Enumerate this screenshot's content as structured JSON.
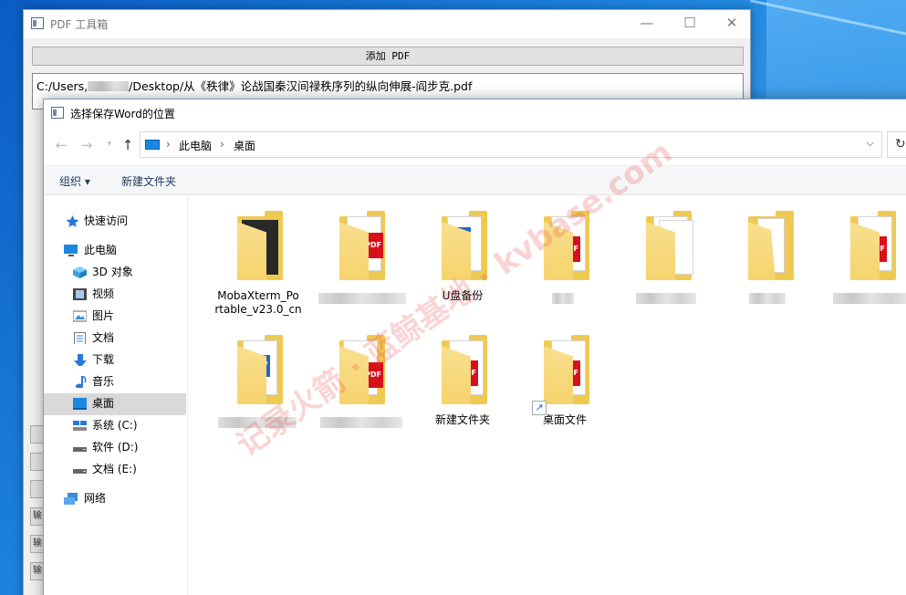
{
  "pdf_window": {
    "title": "PDF 工具箱",
    "add_button": "添加 PDF",
    "path_prefix": "C:/Users,",
    "path_suffix": "/Desktop/从《秩律》论战国秦汉间禄秩序列的纵向伸展-阎步克.pdf",
    "minimize": "—",
    "maximize": "☐",
    "close": "✕",
    "side_stub_1": "输",
    "side_stub_2": "输",
    "side_stub_3": "输"
  },
  "dialog": {
    "title": "选择保存Word的位置",
    "address": {
      "seg1": "此电脑",
      "seg2": "桌面",
      "sep": "›"
    },
    "nav_arrows": {
      "back": "←",
      "forward": "→",
      "recent": "▾",
      "up": "↑",
      "dropdown": "⌵",
      "refresh": "↻"
    },
    "toolbar": {
      "organize": "组织 ▾",
      "new_folder": "新建文件夹"
    },
    "nav_pane": [
      {
        "label": "快速访问",
        "icon": "star-icon"
      },
      {
        "label": "此电脑",
        "icon": "computer-icon"
      },
      {
        "label": "3D 对象",
        "icon": "cube-icon"
      },
      {
        "label": "视频",
        "icon": "video-icon"
      },
      {
        "label": "图片",
        "icon": "picture-icon"
      },
      {
        "label": "文档",
        "icon": "document-icon"
      },
      {
        "label": "下载",
        "icon": "download-icon"
      },
      {
        "label": "音乐",
        "icon": "music-icon"
      },
      {
        "label": "桌面",
        "icon": "desktop-icon",
        "selected": true
      },
      {
        "label": "系统 (C:)",
        "icon": "system-drive-icon"
      },
      {
        "label": "软件 (D:)",
        "icon": "drive-icon"
      },
      {
        "label": "文档 (E:)",
        "icon": "drive-icon"
      },
      {
        "label": "网络",
        "icon": "network-icon"
      }
    ],
    "files": [
      {
        "label": "MobaXterm_Po",
        "label2": "rtable_v23.0_cn",
        "kind": "moba"
      },
      {
        "label": "",
        "kind": "folder-pdf"
      },
      {
        "label": "U盘备份",
        "kind": "folder-word"
      },
      {
        "label": "",
        "kind": "folder-pdf"
      },
      {
        "label": "",
        "kind": "folder-docs"
      },
      {
        "label": "",
        "kind": "folder-open"
      },
      {
        "label": "",
        "kind": "folder-pdf"
      },
      {
        "label": "",
        "kind": "folder-word"
      },
      {
        "label": "",
        "kind": "folder-pdf"
      },
      {
        "label": "新建文件夹",
        "kind": "folder-pdf"
      },
      {
        "label": "桌面文件",
        "kind": "folder-pdf-shortcut"
      }
    ],
    "badges": {
      "pdf": "PDF",
      "word": "W",
      "shortcut": "↗"
    },
    "watermark": "记录火箭 · 蓝鲸基地 · kvbase.com"
  }
}
